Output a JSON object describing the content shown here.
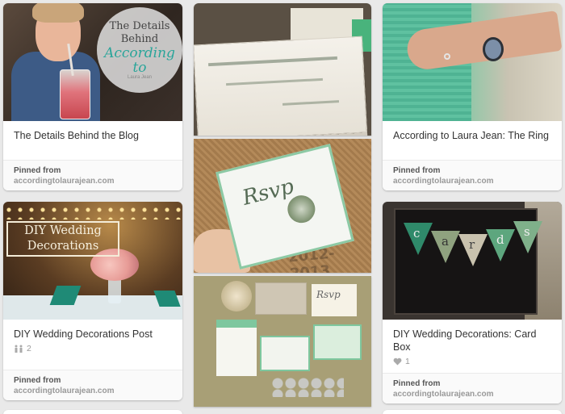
{
  "pins": [
    {
      "title": "The Details Behind the Blog",
      "overlay": {
        "line1": "The Details",
        "line2": "Behind",
        "line3": "According to",
        "line4": "Laura Jean"
      },
      "pinned_from": "Pinned from",
      "domain": "accordingtolaurajean.com"
    },
    {
      "title": "According to Laura Jean: The Ring",
      "pinned_from": "Pinned from",
      "domain": "accordingtolaurajean.com"
    },
    {
      "title": "DIY Wedding Decorations Post",
      "overlay": {
        "line1": "DIY Wedding",
        "line2": "Decorations"
      },
      "repin_count": "2",
      "repin_icon": "repin-icon",
      "pinned_from": "Pinned from",
      "domain": "accordingtolaurajean.com"
    },
    {
      "title": "DIY Wedding Decorations: Card Box",
      "bunting_letters": [
        "c",
        "a",
        "r",
        "d",
        "s"
      ],
      "like_count": "1",
      "like_icon": "heart-icon",
      "pinned_from": "Pinned from",
      "domain": "accordingtolaurajean.com"
    }
  ],
  "middle_column": {
    "invite_text": "Rsvp",
    "rsvp_card_text": "Rsvp",
    "years_text": "2012-2013"
  },
  "colors": {
    "background": "#e9e9e9",
    "card": "#ffffff",
    "accent_teal": "#2aa59a",
    "mint": "#8cc9a4"
  }
}
